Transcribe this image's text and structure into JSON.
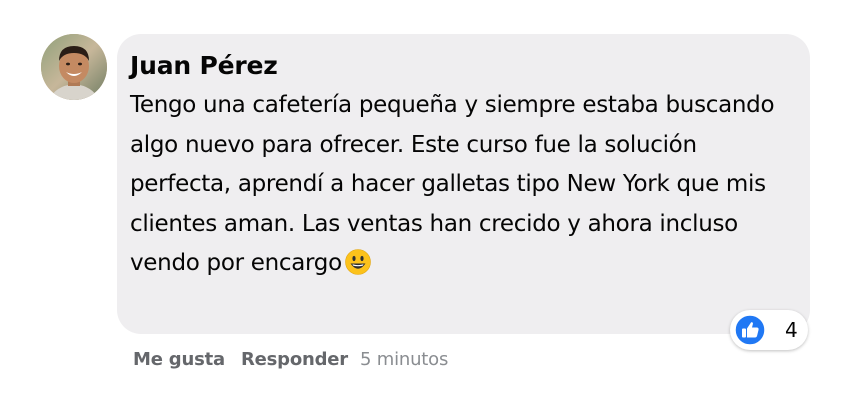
{
  "comment": {
    "author": "Juan Pérez",
    "text": "Tengo una cafetería pequeña y siempre estaba buscando algo nuevo para ofrecer. Este curso fue la solución perfecta, aprendí a hacer galletas tipo New York que mis clientes aman. Las ventas han crecido y ahora incluso vendo por encargo",
    "emoji": "grinning-face-emoji",
    "avatar_icon": "user-avatar-photo"
  },
  "reactions": {
    "icon": "like-thumbs-up-icon",
    "count": "4",
    "color": "#2078f4"
  },
  "actions": {
    "like_label": "Me gusta",
    "reply_label": "Responder",
    "timestamp": "5 minutos"
  },
  "colors": {
    "bubble": "#efeef0",
    "text": "#050505",
    "secondary": "#65676b"
  }
}
